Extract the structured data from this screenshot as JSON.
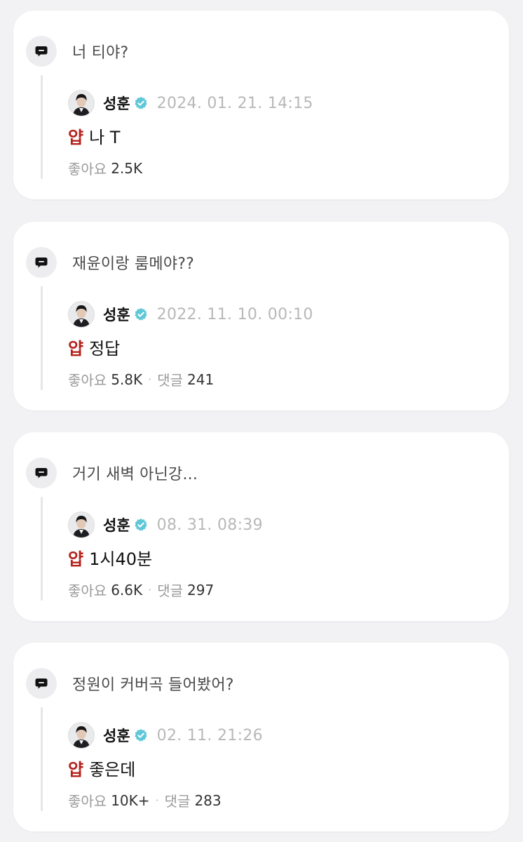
{
  "colors": {
    "background": "#f2f2f4",
    "card": "#ffffff",
    "tag": "#b5211b",
    "verified": "#5ec8d8",
    "timestamp": "#b8b8b8"
  },
  "icons": {
    "question": "chat-bubble-icon",
    "verified": "verified-badge-icon",
    "avatar": "profile-avatar"
  },
  "labels": {
    "likes": "좋아요",
    "comments": "댓글",
    "separator": "·"
  },
  "cards": [
    {
      "question": "너 티야?",
      "author": "성훈",
      "timestamp": "2024. 01. 21. 14:15",
      "tag": "얍",
      "message": "나 T",
      "likes": "2.5K",
      "comments": ""
    },
    {
      "question": "재윤이랑 룸메야??",
      "author": "성훈",
      "timestamp": "2022. 11. 10. 00:10",
      "tag": "얍",
      "message": "정답",
      "likes": "5.8K",
      "comments": "241"
    },
    {
      "question": "거기 새벽 아닌강...",
      "author": "성훈",
      "timestamp": "08. 31. 08:39",
      "tag": "얍",
      "message": "1시40분",
      "likes": "6.6K",
      "comments": "297"
    },
    {
      "question": "정원이 커버곡 들어봤어?",
      "author": "성훈",
      "timestamp": "02. 11. 21:26",
      "tag": "얍",
      "message": "좋은데",
      "likes": "10K+",
      "comments": "283"
    }
  ]
}
